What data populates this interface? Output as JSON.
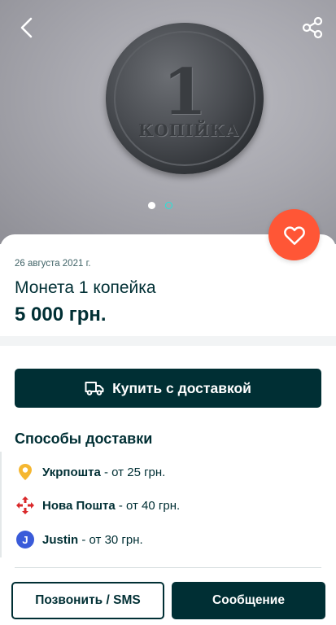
{
  "photo": {
    "coin_number": "1",
    "coin_word": "КОПІЙКА",
    "carousel": {
      "active_index": 0,
      "count": 2
    }
  },
  "icons": {
    "back": "back-arrow-icon",
    "share": "share-icon",
    "favorite": "heart-icon",
    "truck": "truck-icon"
  },
  "listing": {
    "date": "26 августа 2021 г.",
    "title": "Монета 1 копейка",
    "price": "5 000 грн."
  },
  "buy_button_label": "Купить с доставкой",
  "delivery": {
    "heading": "Способы доставки",
    "options": [
      {
        "name": "Укрпошта",
        "price": " - от 25 грн.",
        "icon": "ukrposhta-icon"
      },
      {
        "name": "Нова Пошта",
        "price": " - от 40 грн.",
        "icon": "nova-poshta-icon"
      },
      {
        "name": "Justin",
        "price": " - от 30 грн.",
        "icon": "justin-icon",
        "icon_letter": "J"
      }
    ]
  },
  "actions": {
    "call_label": "Позвонить / SMS",
    "message_label": "Сообщение"
  },
  "colors": {
    "primary": "#002f34",
    "accent_favorite": "#ff5636",
    "carousel_inactive": "#23e5db",
    "ukrposhta": "#f5b731",
    "nova_poshta": "#da292b",
    "justin": "#3a5bd9"
  }
}
